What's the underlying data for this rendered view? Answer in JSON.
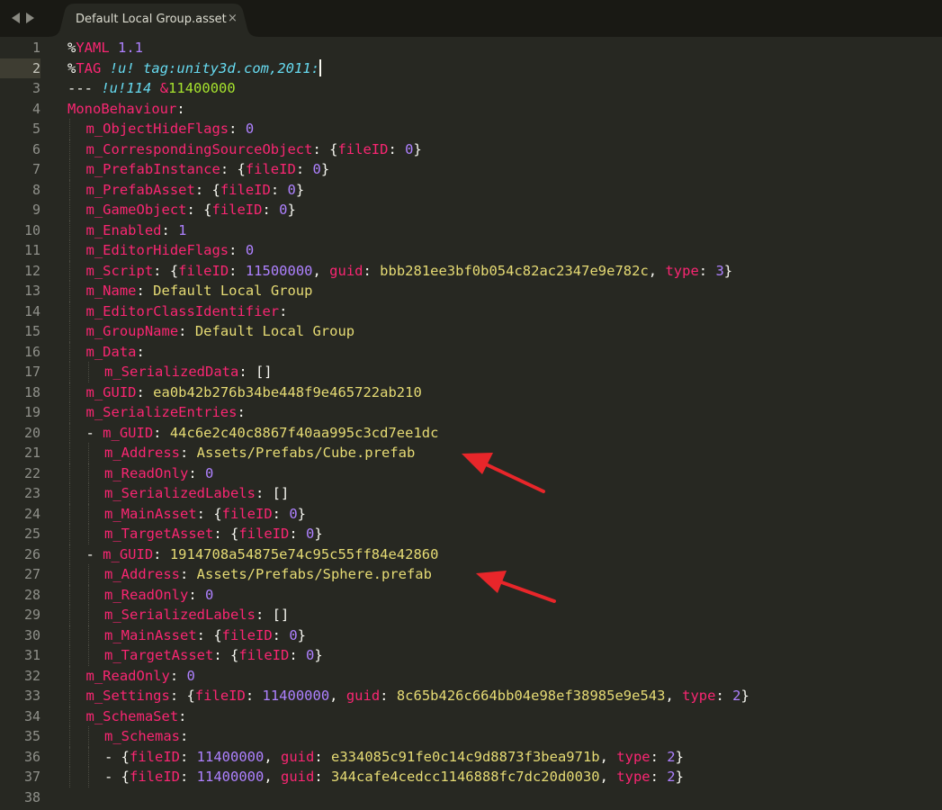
{
  "window": {
    "tab_title": "Default Local Group.asset",
    "close_glyph": "×"
  },
  "colors": {
    "background": "#272822",
    "tabbar": "#191914",
    "key": "#f92672",
    "number": "#ae81ff",
    "string": "#e6db74",
    "type": "#66d9ef",
    "anchor": "#a6e22e",
    "annotation_arrow": "#e8262a"
  },
  "icons": [
    "back-arrow-icon",
    "forward-arrow-icon",
    "close-icon",
    "red-arrow-annotation"
  ],
  "editor": {
    "current_line": 2,
    "lines": [
      {
        "n": "1",
        "indent": 0,
        "tokens": [
          [
            "%",
            "punc"
          ],
          [
            "YAML",
            "key"
          ],
          [
            " 1.1",
            "num"
          ]
        ]
      },
      {
        "n": "2",
        "indent": 0,
        "tokens": [
          [
            "%",
            "punc"
          ],
          [
            "TAG",
            "key"
          ],
          [
            " ",
            "plain"
          ],
          [
            "!u!",
            "type"
          ],
          [
            " ",
            "plain"
          ],
          [
            "tag:unity3d.com,2011:",
            "type"
          ]
        ],
        "caret": true
      },
      {
        "n": "3",
        "indent": 0,
        "tokens": [
          [
            "---",
            "plain"
          ],
          [
            " ",
            "plain"
          ],
          [
            "!u!114",
            "type"
          ],
          [
            " ",
            "plain"
          ],
          [
            "&",
            "key"
          ],
          [
            "11400000",
            "anch"
          ]
        ]
      },
      {
        "n": "4",
        "indent": 0,
        "tokens": [
          [
            "MonoBehaviour",
            "key"
          ],
          [
            ":",
            "punc"
          ]
        ]
      },
      {
        "n": "5",
        "indent": 1,
        "tokens": [
          [
            "m_ObjectHideFlags",
            "key"
          ],
          [
            ": ",
            "punc"
          ],
          [
            "0",
            "num"
          ]
        ]
      },
      {
        "n": "6",
        "indent": 1,
        "tokens": [
          [
            "m_CorrespondingSourceObject",
            "key"
          ],
          [
            ": {",
            "punc"
          ],
          [
            "fileID",
            "key"
          ],
          [
            ": ",
            "punc"
          ],
          [
            "0",
            "num"
          ],
          [
            "}",
            "punc"
          ]
        ]
      },
      {
        "n": "7",
        "indent": 1,
        "tokens": [
          [
            "m_PrefabInstance",
            "key"
          ],
          [
            ": {",
            "punc"
          ],
          [
            "fileID",
            "key"
          ],
          [
            ": ",
            "punc"
          ],
          [
            "0",
            "num"
          ],
          [
            "}",
            "punc"
          ]
        ]
      },
      {
        "n": "8",
        "indent": 1,
        "tokens": [
          [
            "m_PrefabAsset",
            "key"
          ],
          [
            ": {",
            "punc"
          ],
          [
            "fileID",
            "key"
          ],
          [
            ": ",
            "punc"
          ],
          [
            "0",
            "num"
          ],
          [
            "}",
            "punc"
          ]
        ]
      },
      {
        "n": "9",
        "indent": 1,
        "tokens": [
          [
            "m_GameObject",
            "key"
          ],
          [
            ": {",
            "punc"
          ],
          [
            "fileID",
            "key"
          ],
          [
            ": ",
            "punc"
          ],
          [
            "0",
            "num"
          ],
          [
            "}",
            "punc"
          ]
        ]
      },
      {
        "n": "10",
        "indent": 1,
        "tokens": [
          [
            "m_Enabled",
            "key"
          ],
          [
            ": ",
            "punc"
          ],
          [
            "1",
            "num"
          ]
        ]
      },
      {
        "n": "11",
        "indent": 1,
        "tokens": [
          [
            "m_EditorHideFlags",
            "key"
          ],
          [
            ": ",
            "punc"
          ],
          [
            "0",
            "num"
          ]
        ]
      },
      {
        "n": "12",
        "indent": 1,
        "tokens": [
          [
            "m_Script",
            "key"
          ],
          [
            ": {",
            "punc"
          ],
          [
            "fileID",
            "key"
          ],
          [
            ": ",
            "punc"
          ],
          [
            "11500000",
            "num"
          ],
          [
            ", ",
            "punc"
          ],
          [
            "guid",
            "key"
          ],
          [
            ": ",
            "punc"
          ],
          [
            "bbb281ee3bf0b054c82ac2347e9e782c",
            "str"
          ],
          [
            ", ",
            "punc"
          ],
          [
            "type",
            "key"
          ],
          [
            ": ",
            "punc"
          ],
          [
            "3",
            "num"
          ],
          [
            "}",
            "punc"
          ]
        ]
      },
      {
        "n": "13",
        "indent": 1,
        "tokens": [
          [
            "m_Name",
            "key"
          ],
          [
            ": ",
            "punc"
          ],
          [
            "Default Local Group",
            "str"
          ]
        ]
      },
      {
        "n": "14",
        "indent": 1,
        "tokens": [
          [
            "m_EditorClassIdentifier",
            "key"
          ],
          [
            ":",
            "punc"
          ]
        ]
      },
      {
        "n": "15",
        "indent": 1,
        "tokens": [
          [
            "m_GroupName",
            "key"
          ],
          [
            ": ",
            "punc"
          ],
          [
            "Default Local Group",
            "str"
          ]
        ]
      },
      {
        "n": "16",
        "indent": 1,
        "tokens": [
          [
            "m_Data",
            "key"
          ],
          [
            ":",
            "punc"
          ]
        ]
      },
      {
        "n": "17",
        "indent": 2,
        "tokens": [
          [
            "m_SerializedData",
            "key"
          ],
          [
            ": []",
            "punc"
          ]
        ]
      },
      {
        "n": "18",
        "indent": 1,
        "tokens": [
          [
            "m_GUID",
            "key"
          ],
          [
            ": ",
            "punc"
          ],
          [
            "ea0b42b276b34be448f9e465722ab210",
            "str"
          ]
        ]
      },
      {
        "n": "19",
        "indent": 1,
        "tokens": [
          [
            "m_SerializeEntries",
            "key"
          ],
          [
            ":",
            "punc"
          ]
        ]
      },
      {
        "n": "20",
        "indent": 1,
        "tokens": [
          [
            "- ",
            "punc"
          ],
          [
            "m_GUID",
            "key"
          ],
          [
            ": ",
            "punc"
          ],
          [
            "44c6e2c40c8867f40aa995c3cd7ee1dc",
            "str"
          ]
        ]
      },
      {
        "n": "21",
        "indent": 2,
        "tokens": [
          [
            "m_Address",
            "key"
          ],
          [
            ": ",
            "punc"
          ],
          [
            "Assets/Prefabs/Cube.prefab",
            "str"
          ]
        ]
      },
      {
        "n": "22",
        "indent": 2,
        "tokens": [
          [
            "m_ReadOnly",
            "key"
          ],
          [
            ": ",
            "punc"
          ],
          [
            "0",
            "num"
          ]
        ]
      },
      {
        "n": "23",
        "indent": 2,
        "tokens": [
          [
            "m_SerializedLabels",
            "key"
          ],
          [
            ": []",
            "punc"
          ]
        ]
      },
      {
        "n": "24",
        "indent": 2,
        "tokens": [
          [
            "m_MainAsset",
            "key"
          ],
          [
            ": {",
            "punc"
          ],
          [
            "fileID",
            "key"
          ],
          [
            ": ",
            "punc"
          ],
          [
            "0",
            "num"
          ],
          [
            "}",
            "punc"
          ]
        ]
      },
      {
        "n": "25",
        "indent": 2,
        "tokens": [
          [
            "m_TargetAsset",
            "key"
          ],
          [
            ": {",
            "punc"
          ],
          [
            "fileID",
            "key"
          ],
          [
            ": ",
            "punc"
          ],
          [
            "0",
            "num"
          ],
          [
            "}",
            "punc"
          ]
        ]
      },
      {
        "n": "26",
        "indent": 1,
        "tokens": [
          [
            "- ",
            "punc"
          ],
          [
            "m_GUID",
            "key"
          ],
          [
            ": ",
            "punc"
          ],
          [
            "1914708a54875e74c95c55ff84e42860",
            "str"
          ]
        ]
      },
      {
        "n": "27",
        "indent": 2,
        "tokens": [
          [
            "m_Address",
            "key"
          ],
          [
            ": ",
            "punc"
          ],
          [
            "Assets/Prefabs/Sphere.prefab",
            "str"
          ]
        ]
      },
      {
        "n": "28",
        "indent": 2,
        "tokens": [
          [
            "m_ReadOnly",
            "key"
          ],
          [
            ": ",
            "punc"
          ],
          [
            "0",
            "num"
          ]
        ]
      },
      {
        "n": "29",
        "indent": 2,
        "tokens": [
          [
            "m_SerializedLabels",
            "key"
          ],
          [
            ": []",
            "punc"
          ]
        ]
      },
      {
        "n": "30",
        "indent": 2,
        "tokens": [
          [
            "m_MainAsset",
            "key"
          ],
          [
            ": {",
            "punc"
          ],
          [
            "fileID",
            "key"
          ],
          [
            ": ",
            "punc"
          ],
          [
            "0",
            "num"
          ],
          [
            "}",
            "punc"
          ]
        ]
      },
      {
        "n": "31",
        "indent": 2,
        "tokens": [
          [
            "m_TargetAsset",
            "key"
          ],
          [
            ": {",
            "punc"
          ],
          [
            "fileID",
            "key"
          ],
          [
            ": ",
            "punc"
          ],
          [
            "0",
            "num"
          ],
          [
            "}",
            "punc"
          ]
        ]
      },
      {
        "n": "32",
        "indent": 1,
        "tokens": [
          [
            "m_ReadOnly",
            "key"
          ],
          [
            ": ",
            "punc"
          ],
          [
            "0",
            "num"
          ]
        ]
      },
      {
        "n": "33",
        "indent": 1,
        "tokens": [
          [
            "m_Settings",
            "key"
          ],
          [
            ": {",
            "punc"
          ],
          [
            "fileID",
            "key"
          ],
          [
            ": ",
            "punc"
          ],
          [
            "11400000",
            "num"
          ],
          [
            ", ",
            "punc"
          ],
          [
            "guid",
            "key"
          ],
          [
            ": ",
            "punc"
          ],
          [
            "8c65b426c664bb04e98ef38985e9e543",
            "str"
          ],
          [
            ", ",
            "punc"
          ],
          [
            "type",
            "key"
          ],
          [
            ": ",
            "punc"
          ],
          [
            "2",
            "num"
          ],
          [
            "}",
            "punc"
          ]
        ]
      },
      {
        "n": "34",
        "indent": 1,
        "tokens": [
          [
            "m_SchemaSet",
            "key"
          ],
          [
            ":",
            "punc"
          ]
        ]
      },
      {
        "n": "35",
        "indent": 2,
        "tokens": [
          [
            "m_Schemas",
            "key"
          ],
          [
            ":",
            "punc"
          ]
        ]
      },
      {
        "n": "36",
        "indent": 2,
        "tokens": [
          [
            "- {",
            "punc"
          ],
          [
            "fileID",
            "key"
          ],
          [
            ": ",
            "punc"
          ],
          [
            "11400000",
            "num"
          ],
          [
            ", ",
            "punc"
          ],
          [
            "guid",
            "key"
          ],
          [
            ": ",
            "punc"
          ],
          [
            "e334085c91fe0c14c9d8873f3bea971b",
            "str"
          ],
          [
            ", ",
            "punc"
          ],
          [
            "type",
            "key"
          ],
          [
            ": ",
            "punc"
          ],
          [
            "2",
            "num"
          ],
          [
            "}",
            "punc"
          ]
        ]
      },
      {
        "n": "37",
        "indent": 2,
        "tokens": [
          [
            "- {",
            "punc"
          ],
          [
            "fileID",
            "key"
          ],
          [
            ": ",
            "punc"
          ],
          [
            "11400000",
            "num"
          ],
          [
            ", ",
            "punc"
          ],
          [
            "guid",
            "key"
          ],
          [
            ": ",
            "punc"
          ],
          [
            "344cafe4cedcc1146888fc7dc20d0030",
            "str"
          ],
          [
            ", ",
            "punc"
          ],
          [
            "type",
            "key"
          ],
          [
            ": ",
            "punc"
          ],
          [
            "2",
            "num"
          ],
          [
            "}",
            "punc"
          ]
        ]
      },
      {
        "n": "38",
        "indent": 0,
        "tokens": []
      }
    ]
  },
  "annotations": [
    {
      "name": "red-arrow-cube-address",
      "points_to_line": 21
    },
    {
      "name": "red-arrow-sphere-address",
      "points_to_line": 27
    }
  ]
}
